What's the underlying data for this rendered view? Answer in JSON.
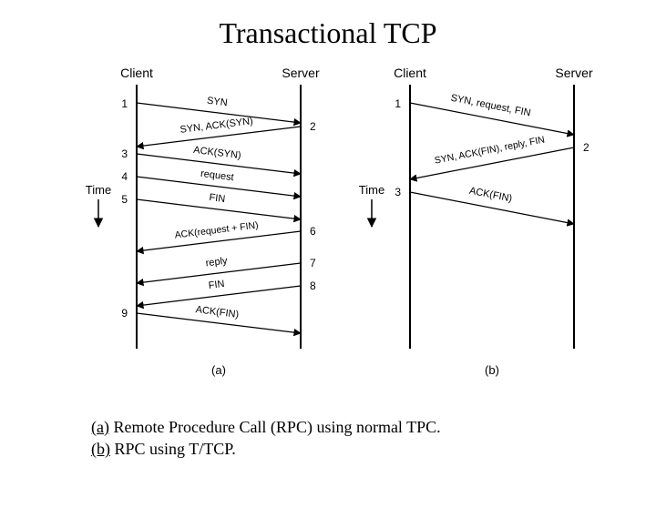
{
  "title": "Transactional TCP",
  "roles": {
    "client": "Client",
    "server": "Server"
  },
  "time_label": "Time",
  "sublabels": {
    "a": "(a)",
    "b": "(b)"
  },
  "caption": {
    "a_prefix": "(a)",
    "a_text": " Remote Procedure Call (RPC) using normal TPC.",
    "b_prefix": "(b)",
    "b_text": " RPC using T/TCP."
  },
  "panel_a": {
    "steps": [
      "1",
      "2",
      "3",
      "4",
      "5",
      "6",
      "7",
      "8",
      "9"
    ],
    "messages": [
      {
        "label": "SYN"
      },
      {
        "label": "SYN, ACK(SYN)"
      },
      {
        "label": "ACK(SYN)"
      },
      {
        "label": "request"
      },
      {
        "label": "FIN"
      },
      {
        "label": "ACK(request + FIN)"
      },
      {
        "label": "reply"
      },
      {
        "label": "FIN"
      },
      {
        "label": "ACK(FIN)"
      }
    ]
  },
  "panel_b": {
    "steps": [
      "1",
      "2",
      "3"
    ],
    "messages": [
      {
        "label": "SYN, request, FIN"
      },
      {
        "label": "SYN, ACK(FIN), reply, FIN"
      },
      {
        "label": "ACK(FIN)"
      }
    ]
  },
  "chart_data": [
    {
      "type": "sequence-diagram",
      "title": "(a) RPC using normal TCP",
      "participants": [
        "Client",
        "Server"
      ],
      "messages": [
        {
          "step": 1,
          "from": "Client",
          "to": "Server",
          "label": "SYN"
        },
        {
          "step": 2,
          "from": "Server",
          "to": "Client",
          "label": "SYN, ACK(SYN)"
        },
        {
          "step": 3,
          "from": "Client",
          "to": "Server",
          "label": "ACK(SYN)"
        },
        {
          "step": 4,
          "from": "Client",
          "to": "Server",
          "label": "request"
        },
        {
          "step": 5,
          "from": "Client",
          "to": "Server",
          "label": "FIN"
        },
        {
          "step": 6,
          "from": "Server",
          "to": "Client",
          "label": "ACK(request + FIN)"
        },
        {
          "step": 7,
          "from": "Server",
          "to": "Client",
          "label": "reply"
        },
        {
          "step": 8,
          "from": "Server",
          "to": "Client",
          "label": "FIN"
        },
        {
          "step": 9,
          "from": "Client",
          "to": "Server",
          "label": "ACK(FIN)"
        }
      ]
    },
    {
      "type": "sequence-diagram",
      "title": "(b) RPC using T/TCP",
      "participants": [
        "Client",
        "Server"
      ],
      "messages": [
        {
          "step": 1,
          "from": "Client",
          "to": "Server",
          "label": "SYN, request, FIN"
        },
        {
          "step": 2,
          "from": "Server",
          "to": "Client",
          "label": "SYN, ACK(FIN), reply, FIN"
        },
        {
          "step": 3,
          "from": "Client",
          "to": "Server",
          "label": "ACK(FIN)"
        }
      ]
    }
  ]
}
